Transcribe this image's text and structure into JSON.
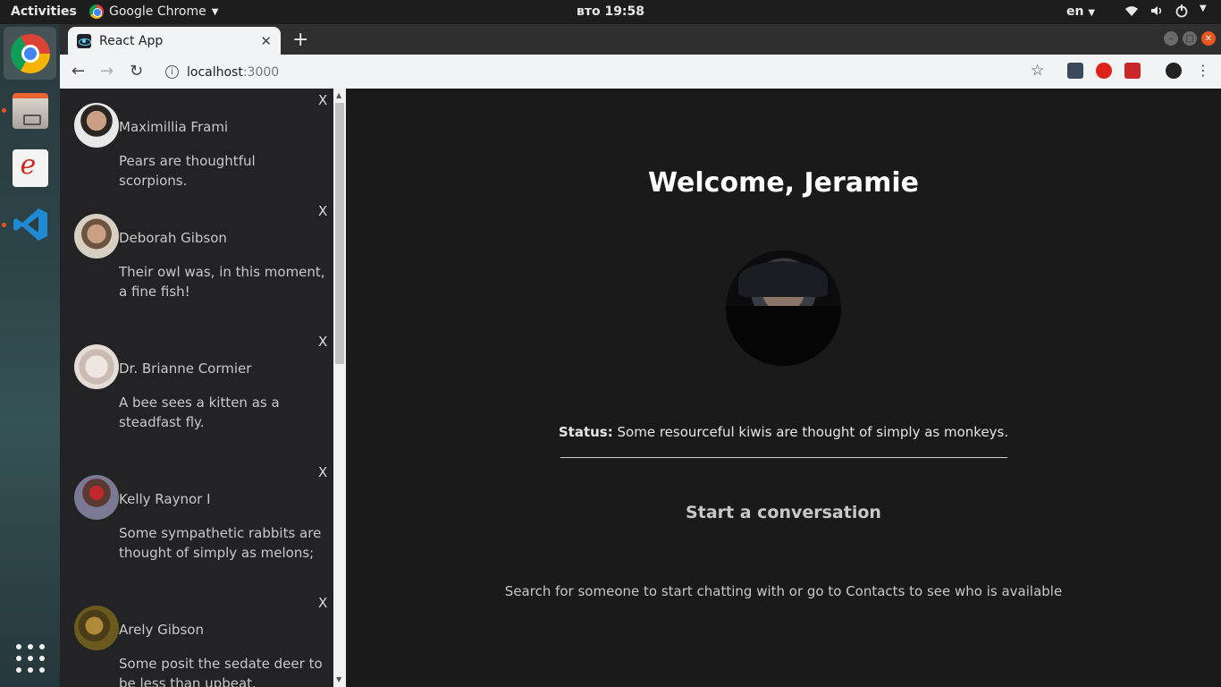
{
  "topbar": {
    "activities": "Activities",
    "app_name": "Google Chrome",
    "clock": "вто 19:58",
    "language": "en"
  },
  "dock": {
    "items": [
      "chrome-icon",
      "files-icon",
      "document-viewer-icon",
      "vscode-icon",
      "show-applications-icon"
    ]
  },
  "browser": {
    "tab_title": "React App",
    "url_host": "localhost",
    "url_port": ":3000"
  },
  "sidebar": {
    "chats": [
      {
        "name": "Maximillia Frami",
        "message": "Pears are thoughtful scorpions.",
        "close": "X",
        "avatar_color": "#5a4a3f"
      },
      {
        "name": "Deborah Gibson",
        "message": "Their owl was, in this moment, a fine fish!",
        "close": "X",
        "avatar_color": "#b8a48c"
      },
      {
        "name": "Dr. Brianne Cormier",
        "message": "A bee sees a kitten as a steadfast fly.",
        "close": "X",
        "avatar_color": "#d9cfc8"
      },
      {
        "name": "Kelly Raynor I",
        "message": "Some sympathetic rabbits are thought of simply as melons;",
        "close": "X",
        "avatar_color": "#6a3a3a"
      },
      {
        "name": "Arely Gibson",
        "message": "Some posit the sedate deer to be less than upbeat.",
        "close": "X",
        "avatar_color": "#6a5a1e"
      }
    ]
  },
  "main": {
    "welcome": "Welcome, Jeramie",
    "status_label": "Status:",
    "status_text": "Some resourceful kiwis are thought of simply as monkeys.",
    "start_title": "Start a conversation",
    "hint": "Search for someone to start chatting with or go to Contacts to see who is available"
  },
  "colors": {
    "background": "#1a1a1b",
    "sidebar": "#232325",
    "ubuntu_orange": "#e95420"
  }
}
